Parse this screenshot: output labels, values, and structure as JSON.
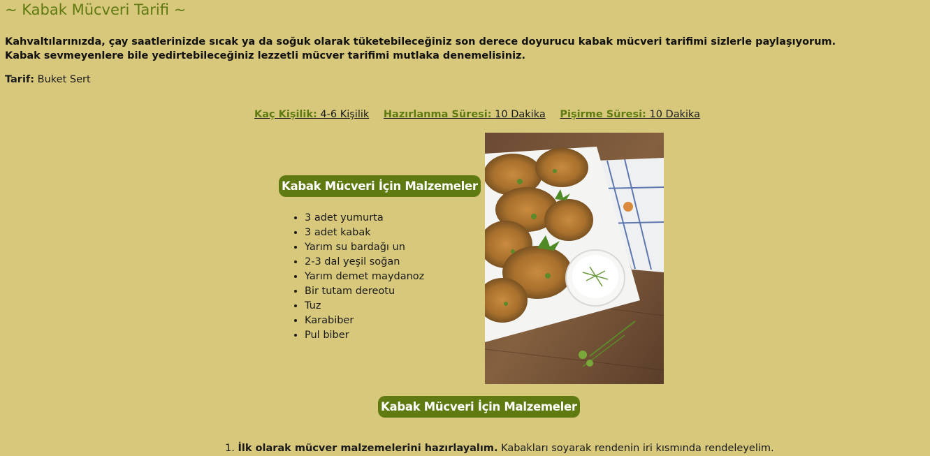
{
  "page": {
    "title": "~ Kabak Mücveri Tarifi ~",
    "intro_line1": "Kahvaltılarınızda, çay saatlerinizde sıcak ya da soğuk olarak tüketebileceğiniz son derece doyurucu kabak mücveri tarifimi sizlerle paylaşıyorum.",
    "intro_line2": "Kabak sevmeyenlere bile yedirtebileceğiniz lezzetli mücver tarifimi mutlaka denemelisiniz.",
    "author_label": "Tarif:",
    "author_name": "Buket Sert"
  },
  "meta": [
    {
      "label": "Kaç Kişilik:",
      "value": "4-6 Kişilik"
    },
    {
      "label": "Hazırlanma Süresi:",
      "value": "10 Dakika"
    },
    {
      "label": "Pişirme Süresi:",
      "value": "10 Dakika"
    }
  ],
  "ingredients": {
    "heading": "Kabak Mücveri İçin Malzemeler",
    "items": [
      "3 adet yumurta",
      "3 adet kabak",
      "Yarım su bardağı un",
      "2-3 dal yeşil soğan",
      "Yarım demet maydanoz",
      "Bir tutam dereotu",
      "Tuz",
      "Karabiber",
      "Pul biber"
    ]
  },
  "preparation": {
    "heading": "Kabak Mücveri İçin Malzemeler",
    "steps": [
      {
        "number": "1.",
        "bold": "İlk olarak mücver malzemelerini hazırlayalım.",
        "text": "Kabakları soyarak rendenin iri kısmında rendeleyelim."
      }
    ]
  },
  "colors": {
    "background": "#d7c87c",
    "accent": "#5f7a10"
  }
}
